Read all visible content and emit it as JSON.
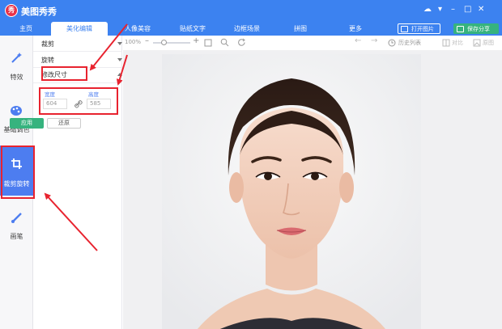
{
  "app": {
    "title": "美图秀秀",
    "logo_glyph": "秀"
  },
  "window_controls": {
    "chat": "☁",
    "menu": "▾",
    "minimize": "–",
    "maximize": "□",
    "close": "✕"
  },
  "tabs": [
    {
      "label": "主页"
    },
    {
      "label": "美化编辑",
      "active": true
    },
    {
      "label": "人像美容"
    },
    {
      "label": "贴纸文字"
    },
    {
      "label": "边框场景"
    },
    {
      "label": "拼图"
    },
    {
      "label": "更多"
    }
  ],
  "top_buttons": {
    "open": "打开图片",
    "save": "保存分享"
  },
  "sidebar": [
    {
      "label": "特效",
      "icon": "magic-wand-icon"
    },
    {
      "label": "基础调色",
      "icon": "palette-icon"
    },
    {
      "label": "裁剪旋转",
      "icon": "crop-icon",
      "active": true
    },
    {
      "label": "画笔",
      "icon": "brush-icon"
    }
  ],
  "panel": {
    "crop": "裁剪",
    "rotate": "旋转",
    "resize": "修改尺寸",
    "width_label": "宽度",
    "height_label": "高度",
    "width_value": "604",
    "height_value": "585",
    "apply": "应用",
    "reset": "还原"
  },
  "toolbar": {
    "zoom": "100%",
    "history": "历史列表",
    "compare": "对比",
    "original": "原图"
  },
  "colors": {
    "brand_blue": "#3c82f0",
    "active_side": "#4d7df0",
    "green": "#36b37e",
    "annotation_red": "#e8232f"
  }
}
